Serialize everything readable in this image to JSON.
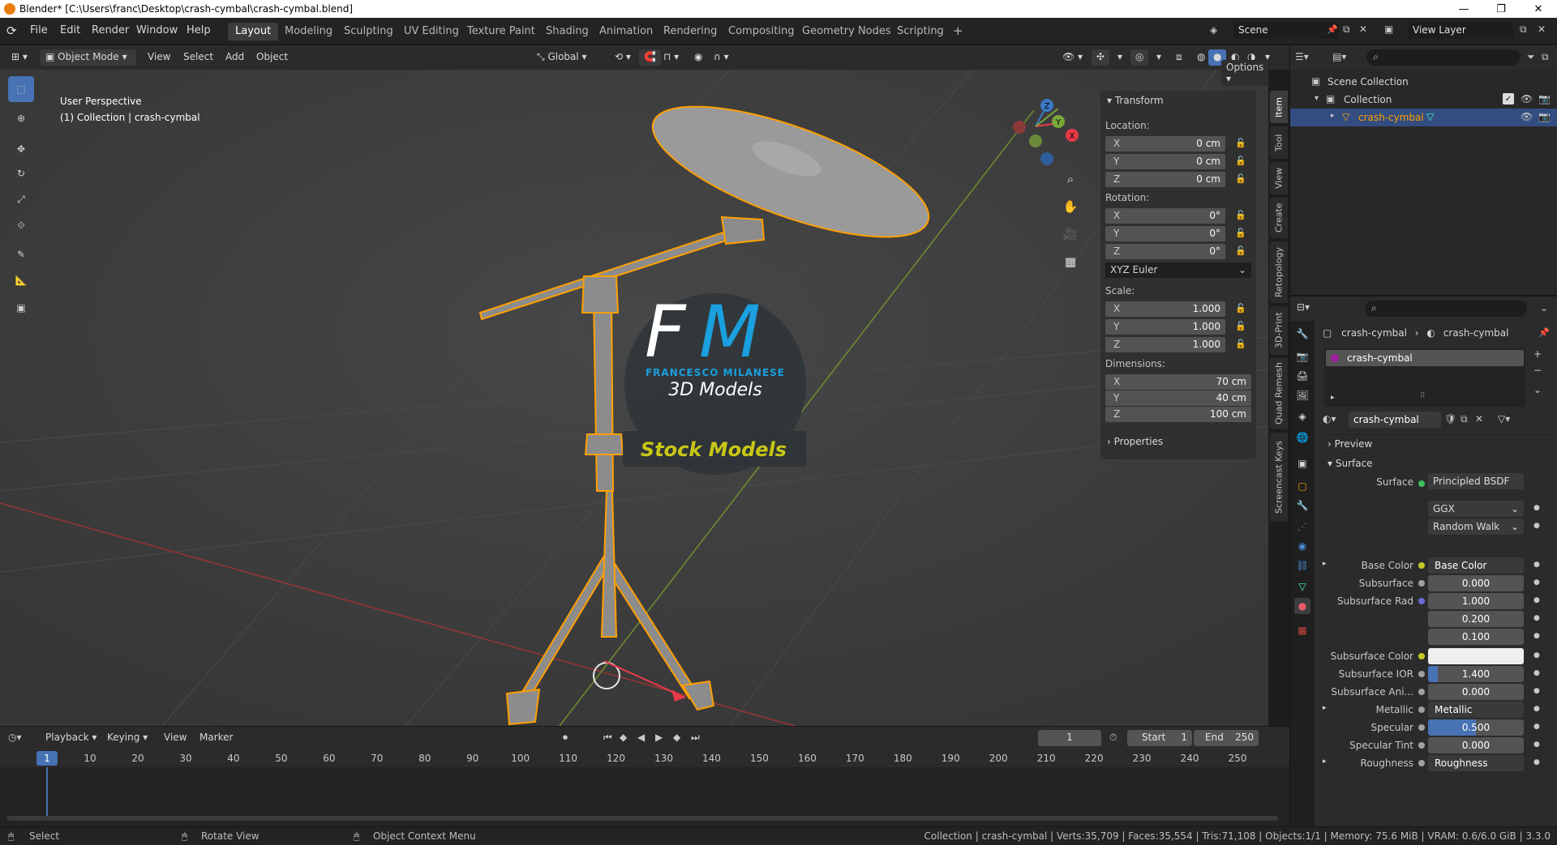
{
  "window": {
    "title": "Blender* [C:\\Users\\franc\\Desktop\\crash-cymbal\\crash-cymbal.blend]",
    "minimize": "—",
    "maximize": "❐",
    "close": "✕"
  },
  "menu": {
    "file": "File",
    "edit": "Edit",
    "render": "Render",
    "window": "Window",
    "help": "Help"
  },
  "workspaces": [
    "Layout",
    "Modeling",
    "Sculpting",
    "UV Editing",
    "Texture Paint",
    "Shading",
    "Animation",
    "Rendering",
    "Compositing",
    "Geometry Nodes",
    "Scripting"
  ],
  "workspace_add": "+",
  "scene": {
    "scene_name": "Scene",
    "view_layer": "View Layer"
  },
  "viewport_header": {
    "mode": "Object Mode",
    "view": "View",
    "select": "Select",
    "add": "Add",
    "object": "Object",
    "transform_orientation": "Global",
    "options": "Options"
  },
  "overlay": {
    "perspective": "User Perspective",
    "collection_info": "(1) Collection | crash-cymbal"
  },
  "gizmo": {
    "x": "X",
    "y": "Y",
    "z": "Z"
  },
  "watermark": {
    "f": "F",
    "m": "M",
    "name": "FRANCESCO MILANESE",
    "sub": "3D Models",
    "banner": "Stock Models"
  },
  "npanel": {
    "transform": "Transform",
    "location_label": "Location:",
    "location": [
      {
        "axis": "X",
        "value": "0 cm"
      },
      {
        "axis": "Y",
        "value": "0 cm"
      },
      {
        "axis": "Z",
        "value": "0 cm"
      }
    ],
    "rotation_label": "Rotation:",
    "rotation": [
      {
        "axis": "X",
        "value": "0°"
      },
      {
        "axis": "Y",
        "value": "0°"
      },
      {
        "axis": "Z",
        "value": "0°"
      }
    ],
    "rotation_mode": "XYZ Euler",
    "scale_label": "Scale:",
    "scale": [
      {
        "axis": "X",
        "value": "1.000"
      },
      {
        "axis": "Y",
        "value": "1.000"
      },
      {
        "axis": "Z",
        "value": "1.000"
      }
    ],
    "dimensions_label": "Dimensions:",
    "dimensions": [
      {
        "axis": "X",
        "value": "70 cm"
      },
      {
        "axis": "Y",
        "value": "40 cm"
      },
      {
        "axis": "Z",
        "value": "100 cm"
      }
    ],
    "properties": "Properties"
  },
  "vtabs": [
    "Item",
    "Tool",
    "View",
    "Create",
    "Retopology",
    "3D-Print",
    "Quad Remesh",
    "Screencast Keys"
  ],
  "outliner": {
    "scene_collection": "Scene Collection",
    "collection": "Collection",
    "object": "crash-cymbal"
  },
  "properties": {
    "breadcrumb_object": "crash-cymbal",
    "breadcrumb_material": "crash-cymbal",
    "slot": "crash-cymbal",
    "material_name": "crash-cymbal",
    "preview": "Preview",
    "surface_section": "Surface",
    "surface_label": "Surface",
    "surface_value": "Principled BSDF",
    "distribution": "GGX",
    "subsurface_method": "Random Walk",
    "rows": [
      {
        "label": "Base Color",
        "value": "Base Color",
        "type": "link"
      },
      {
        "label": "Subsurface",
        "value": "0.000",
        "type": "num"
      },
      {
        "label": "Subsurface Rad",
        "value": "1.000",
        "type": "num"
      },
      {
        "label": "",
        "value": "0.200",
        "type": "num"
      },
      {
        "label": "",
        "value": "0.100",
        "type": "num"
      },
      {
        "label": "Subsurface Color",
        "value": "",
        "type": "color"
      },
      {
        "label": "Subsurface IOR",
        "value": "1.400",
        "type": "num"
      },
      {
        "label": "Subsurface Ani...",
        "value": "0.000",
        "type": "num"
      },
      {
        "label": "Metallic",
        "value": "Metallic",
        "type": "link"
      },
      {
        "label": "Specular",
        "value": "0.500",
        "type": "num"
      },
      {
        "label": "Specular Tint",
        "value": "0.000",
        "type": "num"
      },
      {
        "label": "Roughness",
        "value": "Roughness",
        "type": "link"
      }
    ]
  },
  "timeline": {
    "playback": "Playback",
    "keying": "Keying",
    "view": "View",
    "marker": "Marker",
    "current_frame": "1",
    "start_label": "Start",
    "start": "1",
    "end_label": "End",
    "end": "250",
    "ticks": [
      "1",
      "10",
      "20",
      "30",
      "40",
      "50",
      "60",
      "70",
      "80",
      "90",
      "100",
      "110",
      "120",
      "130",
      "140",
      "150",
      "160",
      "170",
      "180",
      "190",
      "200",
      "210",
      "220",
      "230",
      "240",
      "250"
    ]
  },
  "statusbar": {
    "select": "Select",
    "rotate": "Rotate View",
    "context": "Object Context Menu",
    "stats": "Collection | crash-cymbal | Verts:35,709 | Faces:35,554 | Tris:71,108 | Objects:1/1 | Memory: 75.6 MiB | VRAM: 0.6/6.0 GiB | 3.3.0"
  },
  "colors": {
    "accent": "#4772b3",
    "selection": "#ffa000",
    "brand_blue": "#1a9fdf",
    "banner_yellow": "#c8c814"
  }
}
